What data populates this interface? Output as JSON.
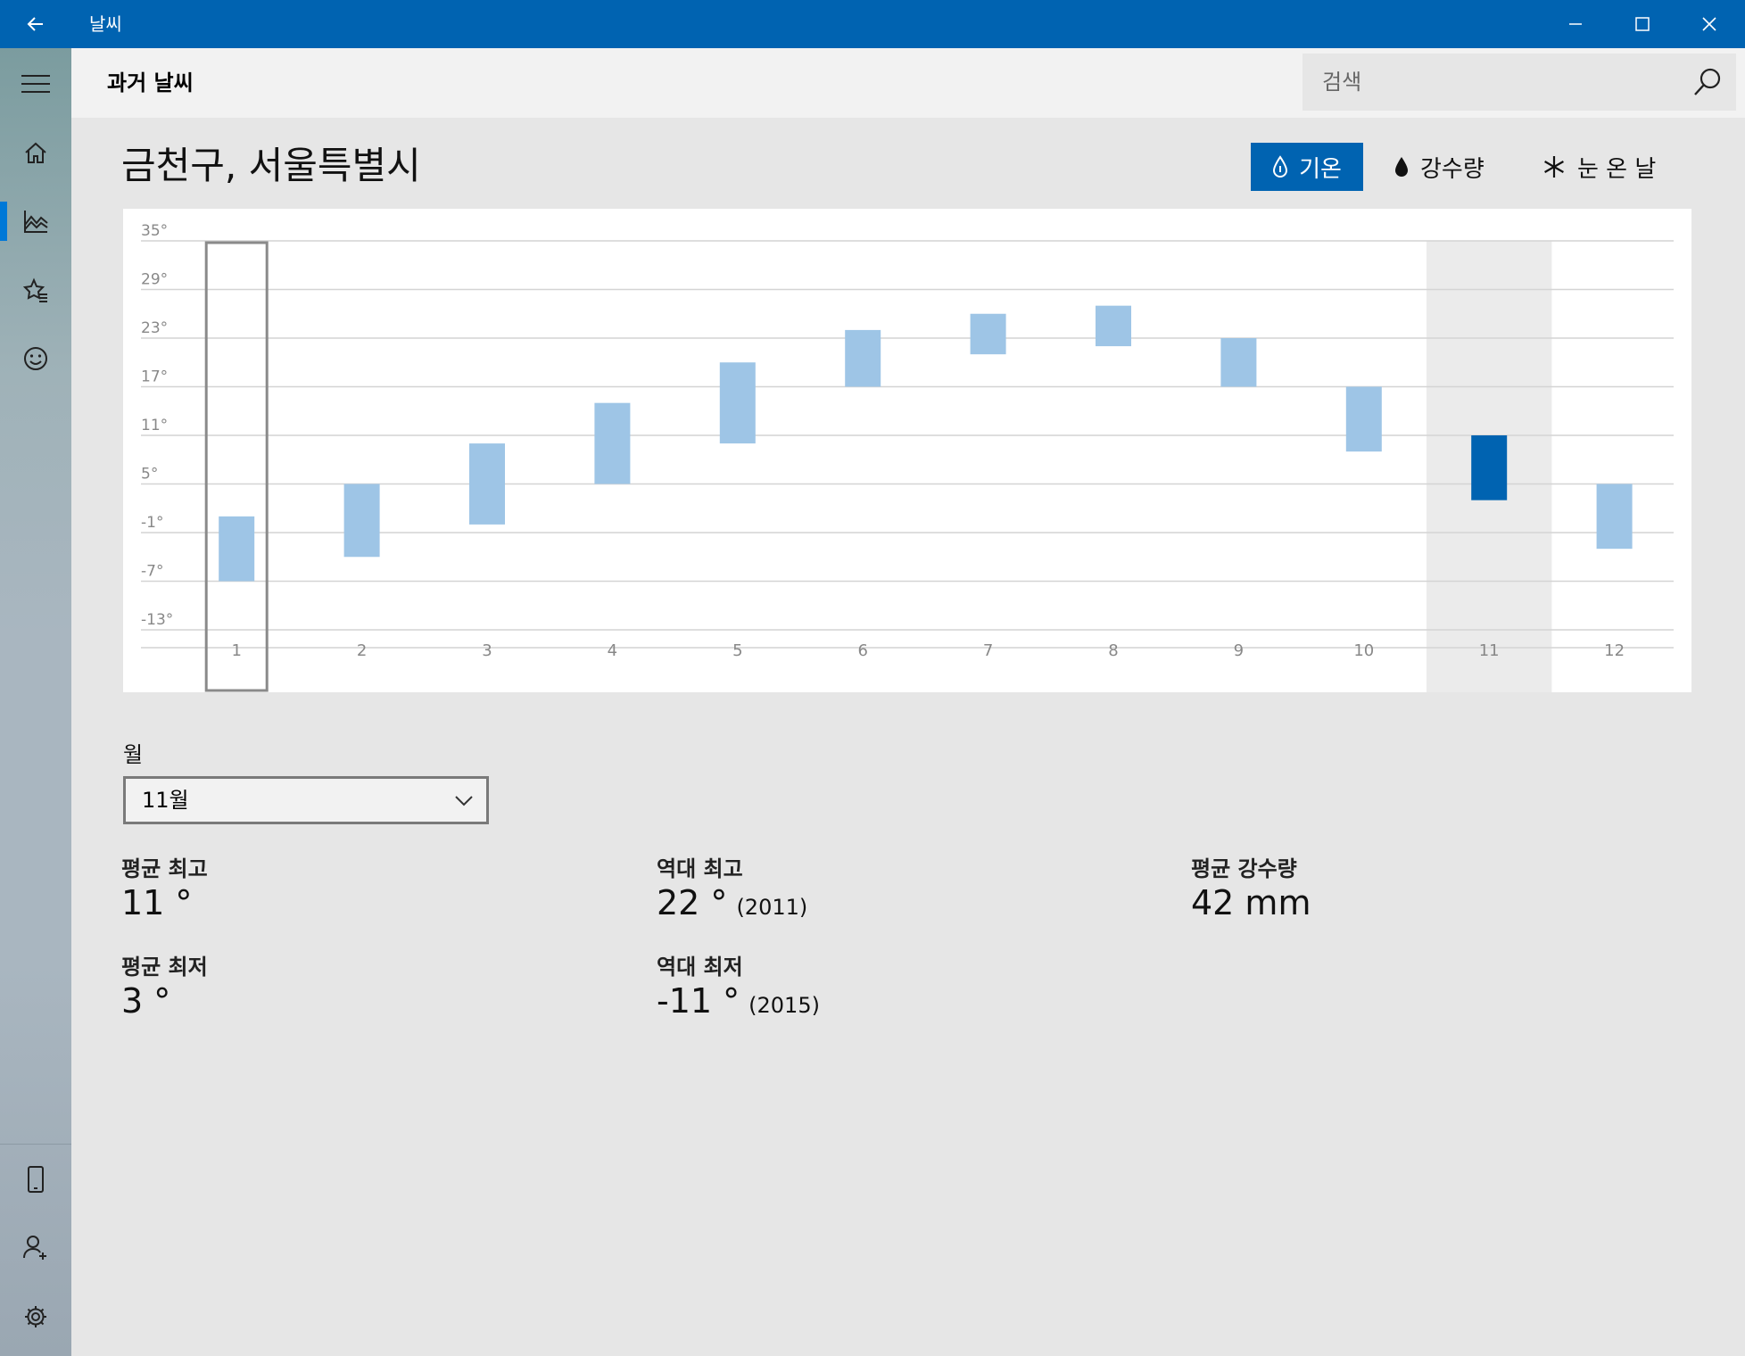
{
  "window": {
    "title": "날씨"
  },
  "header": {
    "title": "과거 날씨",
    "search_placeholder": "검색"
  },
  "location": "금천구, 서울특별시",
  "tabs": [
    {
      "label": "기온",
      "icon": "thermometer-drop-icon",
      "active": true
    },
    {
      "label": "강수량",
      "icon": "raindrop-icon",
      "active": false
    },
    {
      "label": "눈 온 날",
      "icon": "snowflake-icon",
      "active": false
    }
  ],
  "colors": {
    "accent": "#0063b1",
    "bar": "#9ec5e6",
    "bar_selected": "#0063b1",
    "highlight": "#ebebeb"
  },
  "month_selector": {
    "label": "월",
    "value": "11월"
  },
  "stats": {
    "avg_high": {
      "label": "평균 최고",
      "value": "11 °"
    },
    "avg_low": {
      "label": "평균 최저",
      "value": "3 °"
    },
    "record_high": {
      "label": "역대 최고",
      "value": "22 °",
      "year": "(2011)"
    },
    "record_low": {
      "label": "역대 최저",
      "value": "-11 °",
      "year": "(2015)"
    },
    "avg_precip": {
      "label": "평균 강수량",
      "value": "42 mm"
    }
  },
  "chart_data": {
    "type": "bar",
    "subtype": "range",
    "categories": [
      "1",
      "2",
      "3",
      "4",
      "5",
      "6",
      "7",
      "8",
      "9",
      "10",
      "11",
      "12"
    ],
    "series": [
      {
        "low": [
          -7,
          -4,
          0,
          5,
          10,
          17,
          21,
          22,
          17,
          9,
          3,
          -3
        ],
        "high": [
          1,
          5,
          10,
          15,
          20,
          24,
          26,
          27,
          23,
          17,
          11,
          5
        ]
      }
    ],
    "y_ticks": [
      "35°",
      "29°",
      "23°",
      "17°",
      "11°",
      "5°",
      "-1°",
      "-7°",
      "-13°"
    ],
    "ylim": [
      -13,
      35
    ],
    "grid": true,
    "selected_category": "11",
    "hover_category": "1"
  }
}
